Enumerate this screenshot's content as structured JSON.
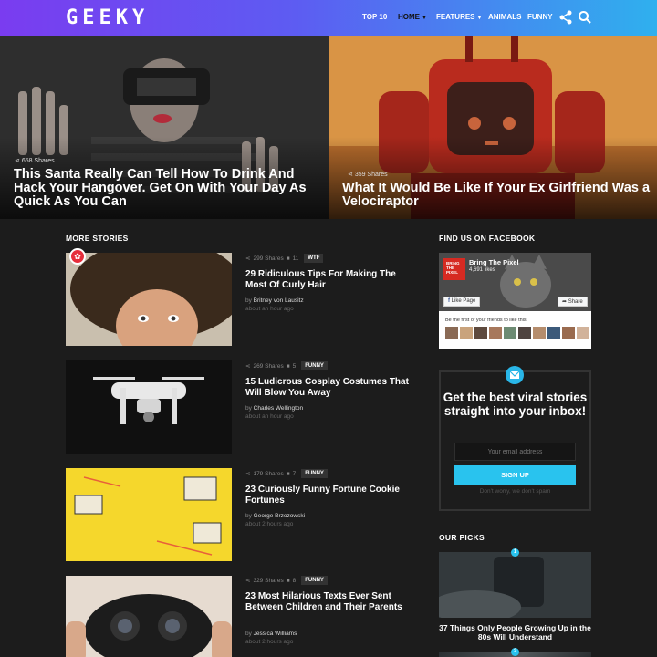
{
  "header": {
    "logo": "GEEKY",
    "nav": [
      {
        "label": "TOP 10"
      },
      {
        "label": "HOME"
      },
      {
        "label": "FEATURES"
      },
      {
        "label": "ANIMALS"
      },
      {
        "label": "FUNNY"
      }
    ],
    "icons": [
      "share-icon",
      "search-icon"
    ]
  },
  "hero": [
    {
      "shares": "658 Shares",
      "title": "This Santa Really Can Tell How To Drink And Hack Your Hangover. Get On With Your Day As Quick As You Can"
    },
    {
      "shares": "359 Shares",
      "title": "What It Would Be Like If Your Ex Girlfriend Was a Velociraptor"
    }
  ],
  "more_stories": {
    "heading": "MORE STORIES",
    "items": [
      {
        "shares": "299 Shares",
        "comments": "11",
        "tag": "WTF",
        "title": "29 Ridiculous Tips For Making The Most Of Curly Hair",
        "author": "Britney von Lausitz",
        "time": "about an hour ago",
        "hot": true
      },
      {
        "shares": "269 Shares",
        "comments": "5",
        "tag": "FUNNY",
        "title": "15 Ludicrous Cosplay Costumes That Will Blow You Away",
        "author": "Charles Wellington",
        "time": "about an hour ago"
      },
      {
        "shares": "179 Shares",
        "comments": "7",
        "tag": "FUNNY",
        "title": "23 Curiously Funny Fortune Cookie Fortunes",
        "author": "George Brzozowski",
        "time": "about 2 hours ago"
      },
      {
        "shares": "329 Shares",
        "comments": "8",
        "tag": "FUNNY",
        "title": "23 Most Hilarious Texts Ever Sent Between Children and Their Parents",
        "author": "Jessica Williams",
        "time": "about 2 hours ago"
      }
    ]
  },
  "facebook": {
    "heading": "FIND US ON FACEBOOK",
    "logo_text": "BRING THE PIXEL",
    "page_name": "Bring The Pixel",
    "likes": "4,691 likes",
    "like_label": "Like Page",
    "share_label": "Share",
    "friends_text": "Be the first of your friends to like this"
  },
  "newsletter": {
    "title": "Get the best viral stories straight into your inbox!",
    "placeholder": "Your email address",
    "button": "SIGN UP",
    "note": "Don't worry, we don't spam"
  },
  "picks": {
    "heading": "OUR PICKS",
    "items": [
      {
        "num": "1",
        "title": "37 Things Only People Growing Up in the 80s Will Understand"
      },
      {
        "num": "2"
      }
    ]
  },
  "colors": {
    "accent": "#29c3ee",
    "header_start": "#7a3cf0",
    "header_end": "#2fb0ee",
    "hot": "#e62e3b"
  }
}
